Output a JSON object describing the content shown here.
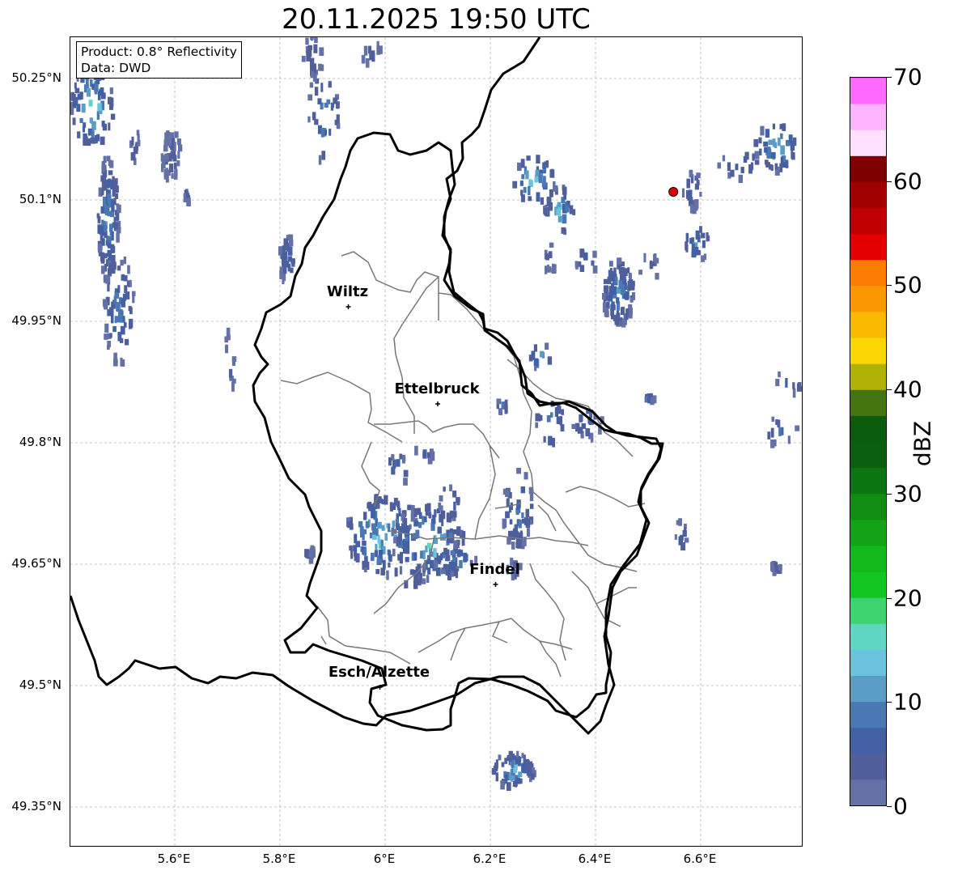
{
  "title": "20.11.2025 19:50 UTC",
  "info": {
    "product": "Product: 0.8° Reflectivity",
    "data": "Data: DWD"
  },
  "map_extent": {
    "lon_min": 5.4,
    "lon_max": 6.8,
    "lat_min": 49.3,
    "lat_max": 50.3
  },
  "lat_ticks": [
    {
      "value": 50.25,
      "label": "50.25°N"
    },
    {
      "value": 50.1,
      "label": "50.1°N"
    },
    {
      "value": 49.95,
      "label": "49.95°N"
    },
    {
      "value": 49.8,
      "label": "49.8°N"
    },
    {
      "value": 49.65,
      "label": "49.65°N"
    },
    {
      "value": 49.5,
      "label": "49.5°N"
    },
    {
      "value": 49.35,
      "label": "49.35°N"
    }
  ],
  "lon_ticks": [
    {
      "value": 5.6,
      "label": "5.6°E"
    },
    {
      "value": 5.8,
      "label": "5.8°E"
    },
    {
      "value": 6.0,
      "label": "6°E"
    },
    {
      "value": 6.2,
      "label": "6.2°E"
    },
    {
      "value": 6.4,
      "label": "6.4°E"
    },
    {
      "value": 6.6,
      "label": "6.6°E"
    }
  ],
  "cities": [
    {
      "name": "Wiltz",
      "lon": 5.93,
      "lat": 49.968
    },
    {
      "name": "Ettelbruck",
      "lon": 6.1,
      "lat": 49.848
    },
    {
      "name": "Findel",
      "lon": 6.21,
      "lat": 49.625
    },
    {
      "name": "Esch/Alzette",
      "lon": 5.99,
      "lat": 49.498
    }
  ],
  "radar_site": {
    "lon": 6.548,
    "lat": 50.11,
    "color": "#e00000"
  },
  "colorbar": {
    "label": "dBZ",
    "vmin": 0,
    "vmax": 70,
    "step": 2.5,
    "ticks": [
      "0",
      "10",
      "20",
      "30",
      "40",
      "50",
      "60",
      "70"
    ],
    "colors": [
      "#6371a6",
      "#505f9c",
      "#4260a3",
      "#4a78b2",
      "#5a9ec8",
      "#69c2de",
      "#5fd6c3",
      "#3dd46f",
      "#12c622",
      "#13b81b",
      "#11a414",
      "#0f8e12",
      "#0b7611",
      "#0b6010",
      "#0b5c0f",
      "#437511",
      "#b0b206",
      "#fbd701",
      "#fbb801",
      "#fb9701",
      "#fb7d02",
      "#e40000",
      "#c00000",
      "#a00000",
      "#7f0000",
      "#ffe0ff",
      "#ffb4ff",
      "#ff69ff",
      "#e93cf0"
    ]
  },
  "radar_cells": [
    [
      5.44,
      50.22,
      0.04,
      0.05,
      3,
      20
    ],
    [
      5.47,
      50.08,
      0.02,
      0.08,
      2,
      14
    ],
    [
      5.49,
      49.97,
      0.03,
      0.07,
      3,
      12
    ],
    [
      5.52,
      50.17,
      0.01,
      0.03,
      3,
      6
    ],
    [
      5.59,
      50.16,
      0.02,
      0.03,
      2,
      6
    ],
    [
      5.62,
      50.11,
      0.005,
      0.01,
      5,
      6
    ],
    [
      5.88,
      50.21,
      0.03,
      0.06,
      4,
      12
    ],
    [
      5.86,
      50.28,
      0.02,
      0.03,
      3,
      6
    ],
    [
      5.81,
      50.03,
      0.015,
      0.03,
      2,
      10
    ],
    [
      5.7,
      49.9,
      0.01,
      0.05,
      4,
      6
    ],
    [
      5.97,
      50.29,
      0.02,
      0.02,
      4,
      6
    ],
    [
      6.28,
      50.13,
      0.04,
      0.03,
      3,
      18
    ],
    [
      6.33,
      50.09,
      0.03,
      0.03,
      3,
      16
    ],
    [
      6.31,
      50.03,
      0.01,
      0.02,
      5,
      6
    ],
    [
      6.38,
      50.03,
      0.02,
      0.02,
      4,
      10
    ],
    [
      6.44,
      49.99,
      0.03,
      0.04,
      2,
      14
    ],
    [
      6.5,
      50.02,
      0.02,
      0.02,
      4,
      8
    ],
    [
      6.58,
      50.12,
      0.02,
      0.03,
      3,
      8
    ],
    [
      6.59,
      50.05,
      0.03,
      0.02,
      3,
      14
    ],
    [
      6.67,
      50.15,
      0.04,
      0.02,
      4,
      10
    ],
    [
      6.74,
      50.17,
      0.04,
      0.03,
      3,
      18
    ],
    [
      6.29,
      49.91,
      0.02,
      0.02,
      5,
      14
    ],
    [
      6.31,
      49.83,
      0.03,
      0.03,
      4,
      14
    ],
    [
      6.38,
      49.83,
      0.03,
      0.02,
      3,
      10
    ],
    [
      6.5,
      49.86,
      0.01,
      0.005,
      5,
      8
    ],
    [
      6.77,
      49.88,
      0.03,
      0.015,
      4,
      10
    ],
    [
      6.75,
      49.82,
      0.03,
      0.02,
      4,
      10
    ],
    [
      6.56,
      49.69,
      0.01,
      0.02,
      5,
      10
    ],
    [
      6.74,
      49.65,
      0.01,
      0.005,
      5,
      8
    ],
    [
      5.99,
      49.69,
      0.07,
      0.05,
      3,
      18
    ],
    [
      6.08,
      49.68,
      0.07,
      0.05,
      3,
      18
    ],
    [
      6.05,
      49.64,
      0.03,
      0.02,
      4,
      10
    ],
    [
      6.02,
      49.77,
      0.02,
      0.02,
      4,
      14
    ],
    [
      6.07,
      49.79,
      0.02,
      0.01,
      5,
      8
    ],
    [
      6.12,
      49.73,
      0.02,
      0.02,
      4,
      14
    ],
    [
      6.13,
      49.66,
      0.04,
      0.02,
      3,
      12
    ],
    [
      6.25,
      49.72,
      0.03,
      0.05,
      3,
      12
    ],
    [
      6.24,
      49.65,
      0.015,
      0.01,
      4,
      8
    ],
    [
      6.24,
      49.4,
      0.04,
      0.02,
      2,
      18
    ],
    [
      6.22,
      49.85,
      0.01,
      0.01,
      5,
      14
    ],
    [
      5.85,
      49.67,
      0.01,
      0.01,
      5,
      6
    ]
  ]
}
